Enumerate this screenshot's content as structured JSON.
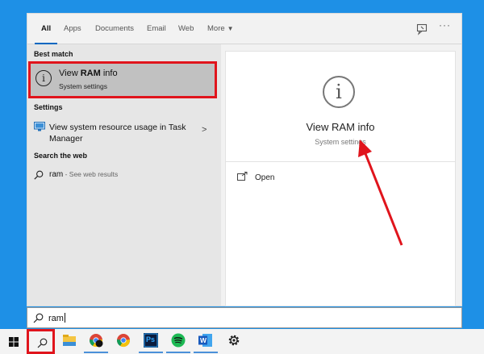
{
  "tabs": {
    "items": [
      "All",
      "Apps",
      "Documents",
      "Email",
      "Web",
      "More"
    ],
    "more_caret": "▼",
    "more_dots": "···"
  },
  "best_match": {
    "heading": "Best match",
    "title_prefix": "View ",
    "title_bold": "RAM",
    "title_suffix": " info",
    "subtitle": "System settings",
    "icon": "info-circle-icon"
  },
  "settings": {
    "heading": "Settings",
    "item_label": "View system resource usage in Task Manager",
    "icon": "monitor-icon"
  },
  "web": {
    "heading": "Search the web",
    "query": "ram",
    "suffix": " - See web results"
  },
  "detail": {
    "title": "View RAM info",
    "subtitle": "System settings",
    "action_label": "Open"
  },
  "search_box": {
    "value": "ram"
  },
  "taskbar": {
    "apps": [
      "windows-start-icon",
      "search-icon",
      "file-explorer-icon",
      "chrome-icon",
      "chrome-icon",
      "photoshop-icon",
      "spotify-icon",
      "word-icon",
      "settings-icon"
    ],
    "photoshop_text": "Ps",
    "word_text": "W"
  },
  "colors": {
    "highlight": "#e0141c",
    "accent": "#0067c0",
    "desktop": "#1e90e6"
  }
}
